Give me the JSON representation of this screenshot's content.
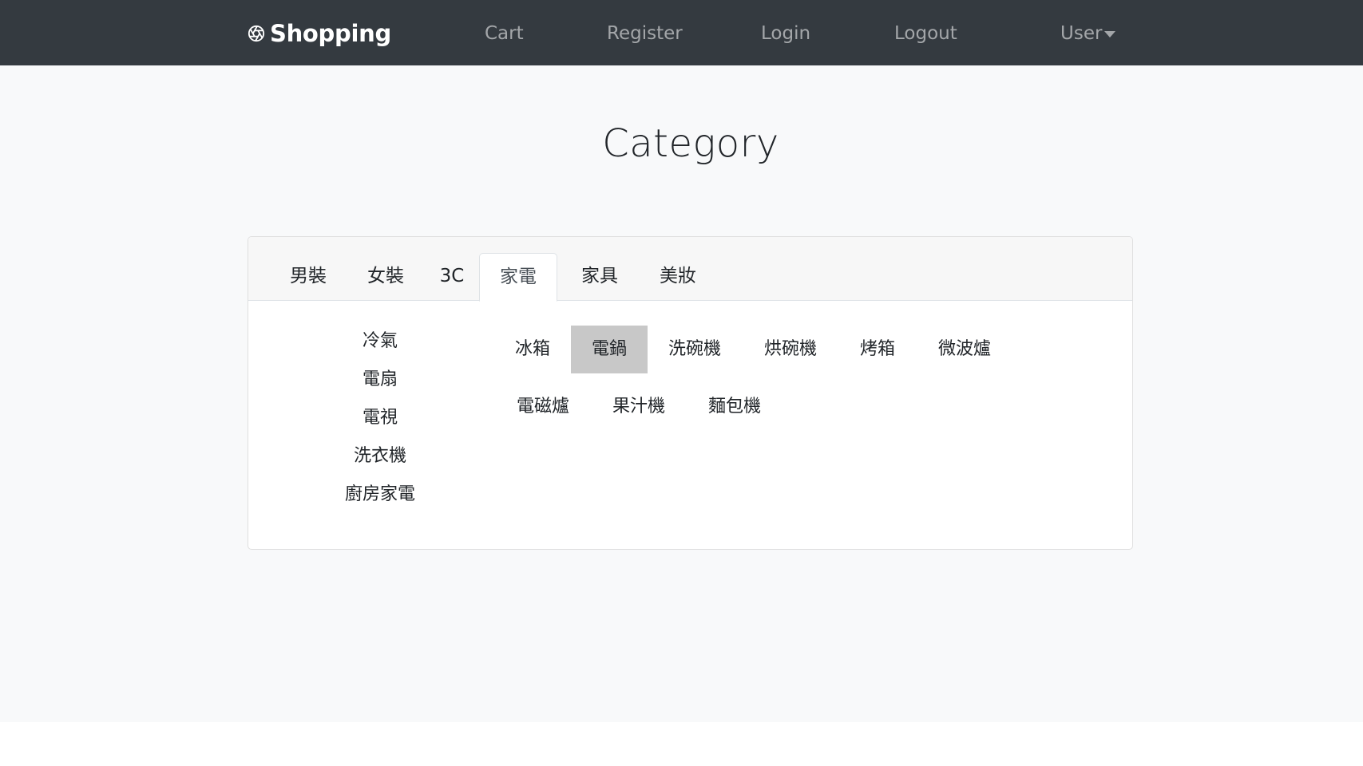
{
  "navbar": {
    "brand": "Shopping",
    "brand_icon": "aperture-icon",
    "links": {
      "cart": "Cart",
      "register": "Register",
      "login": "Login",
      "logout": "Logout",
      "user": "User"
    }
  },
  "heading": "Category",
  "tabs": [
    {
      "label": "男裝"
    },
    {
      "label": "女裝"
    },
    {
      "label": "3C"
    },
    {
      "label": "家電",
      "active": true
    },
    {
      "label": "家具"
    },
    {
      "label": "美妝"
    }
  ],
  "side_list": [
    "冷氣",
    "電扇",
    "電視",
    "洗衣機",
    "廚房家電"
  ],
  "sub_items": [
    "冰箱",
    "電鍋",
    "洗碗機",
    "烘碗機",
    "烤箱",
    "微波爐",
    "電磁爐",
    "果汁機",
    "麵包機"
  ],
  "selected_sub_item": "電鍋",
  "colors": {
    "navbar_bg": "#343a40",
    "page_bg": "#f8f9fa",
    "highlight_bg": "#c8c8c8"
  }
}
